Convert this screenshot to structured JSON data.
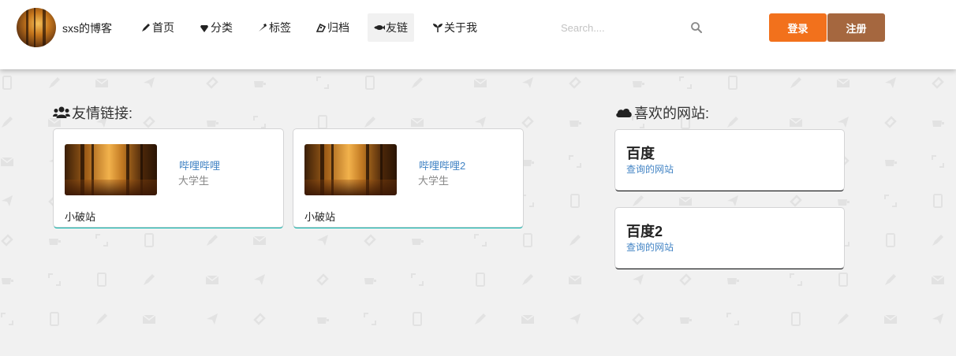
{
  "header": {
    "brand": "sxs的博客",
    "nav": [
      {
        "label": "首页",
        "icon": "pen-icon",
        "active": false
      },
      {
        "label": "分类",
        "icon": "diamond-icon",
        "active": false
      },
      {
        "label": "标签",
        "icon": "tag-icon",
        "active": false
      },
      {
        "label": "归档",
        "icon": "archive-icon",
        "active": false
      },
      {
        "label": "友链",
        "icon": "fish-icon",
        "active": true
      },
      {
        "label": "关于我",
        "icon": "leaf-icon",
        "active": false
      }
    ],
    "search": {
      "placeholder": "Search...."
    },
    "login_label": "登录",
    "register_label": "注册",
    "colors": {
      "login": "#f2711c",
      "register": "#a5673f",
      "active_nav": "#f1f1f1"
    }
  },
  "friends": {
    "title": "友情链接:",
    "icon": "users-icon",
    "cards": [
      {
        "name": "哔哩哔哩",
        "role": "大学生",
        "desc": "小破站"
      },
      {
        "name": "哔哩哔哩2",
        "role": "大学生",
        "desc": "小破站"
      }
    ],
    "accent": "#00b5ad"
  },
  "sites": {
    "title": "喜欢的网站:",
    "icon": "cloud-icon",
    "cards": [
      {
        "name": "百度",
        "desc": "查询的网站"
      },
      {
        "name": "百度2",
        "desc": "查询的网站"
      }
    ]
  }
}
